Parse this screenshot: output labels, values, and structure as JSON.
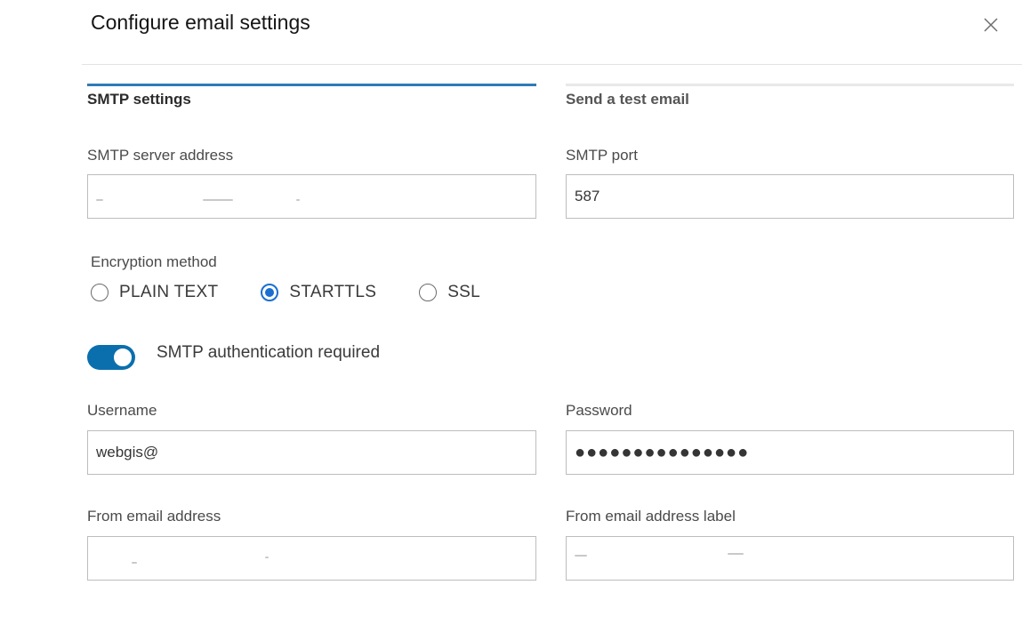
{
  "dialog": {
    "title": "Configure email settings"
  },
  "tabs": [
    {
      "label": "SMTP settings",
      "active": true
    },
    {
      "label": "Send a test email",
      "active": false
    }
  ],
  "fields": {
    "smtp_server": {
      "label": "SMTP server address",
      "value": ""
    },
    "smtp_port": {
      "label": "SMTP port",
      "value": "587"
    },
    "username": {
      "label": "Username",
      "value": "webgis@"
    },
    "password": {
      "label": "Password",
      "value": "●●●●●●●●●●●●●●●"
    },
    "from_email": {
      "label": "From email address",
      "value": ""
    },
    "from_label": {
      "label": "From email address label",
      "value": ""
    }
  },
  "encryption": {
    "label": "Encryption method",
    "options": [
      "PLAIN TEXT",
      "STARTTLS",
      "SSL"
    ],
    "selected": "STARTTLS"
  },
  "auth_toggle": {
    "label": "SMTP authentication required",
    "on": true
  },
  "icons": {
    "close": "close-icon"
  },
  "colors": {
    "active_tab": "#2f7bb8",
    "radio_selected": "#1a6fd1",
    "toggle_on": "#0b6fae"
  }
}
